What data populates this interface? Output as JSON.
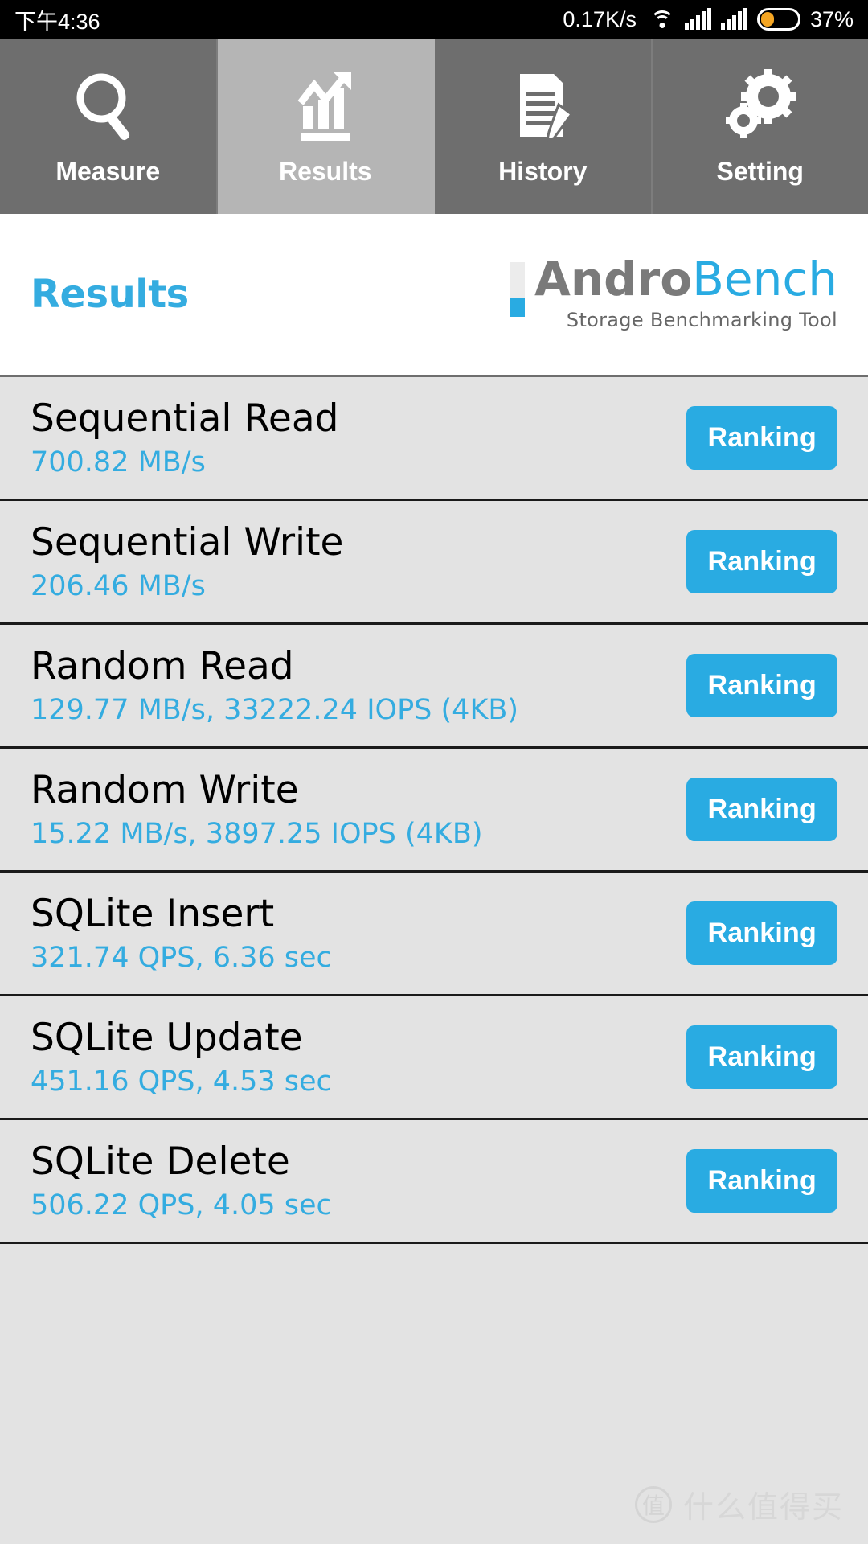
{
  "status_bar": {
    "time": "下午4:36",
    "network_speed": "0.17K/s",
    "wifi_icon": "wifi-icon",
    "signal_icon_1": "signal-bars-icon",
    "signal_icon_2": "signal-bars-icon",
    "battery_icon": "battery-icon",
    "battery_percent": "37%",
    "battery_level": 37,
    "battery_color": "#f5a623"
  },
  "tabs": [
    {
      "label": "Measure",
      "icon": "magnifier-icon",
      "active": false
    },
    {
      "label": "Results",
      "icon": "bar-chart-arrow-icon",
      "active": true
    },
    {
      "label": "History",
      "icon": "document-pen-icon",
      "active": false
    },
    {
      "label": "Setting",
      "icon": "gears-icon",
      "active": false
    }
  ],
  "header": {
    "title": "Results",
    "logo_primary": "Andro",
    "logo_secondary": "Bench",
    "logo_subtitle": "Storage Benchmarking Tool"
  },
  "colors": {
    "accent_blue": "#29abe2",
    "value_blue": "#34ace0",
    "tab_bg": "#6e6e6e",
    "tab_active_bg": "#b5b5b5",
    "list_bg": "#e3e3e3"
  },
  "results": [
    {
      "name": "Sequential Read",
      "value": "700.82 MB/s",
      "button": "Ranking"
    },
    {
      "name": "Sequential Write",
      "value": "206.46 MB/s",
      "button": "Ranking"
    },
    {
      "name": "Random Read",
      "value": "129.77 MB/s, 33222.24 IOPS (4KB)",
      "button": "Ranking"
    },
    {
      "name": "Random Write",
      "value": "15.22 MB/s, 3897.25 IOPS (4KB)",
      "button": "Ranking"
    },
    {
      "name": "SQLite Insert",
      "value": "321.74 QPS, 6.36 sec",
      "button": "Ranking"
    },
    {
      "name": "SQLite Update",
      "value": "451.16 QPS, 4.53 sec",
      "button": "Ranking"
    },
    {
      "name": "SQLite Delete",
      "value": "506.22 QPS, 4.05 sec",
      "button": "Ranking"
    }
  ],
  "watermark": {
    "logo_char": "值",
    "text": "什么值得买"
  }
}
